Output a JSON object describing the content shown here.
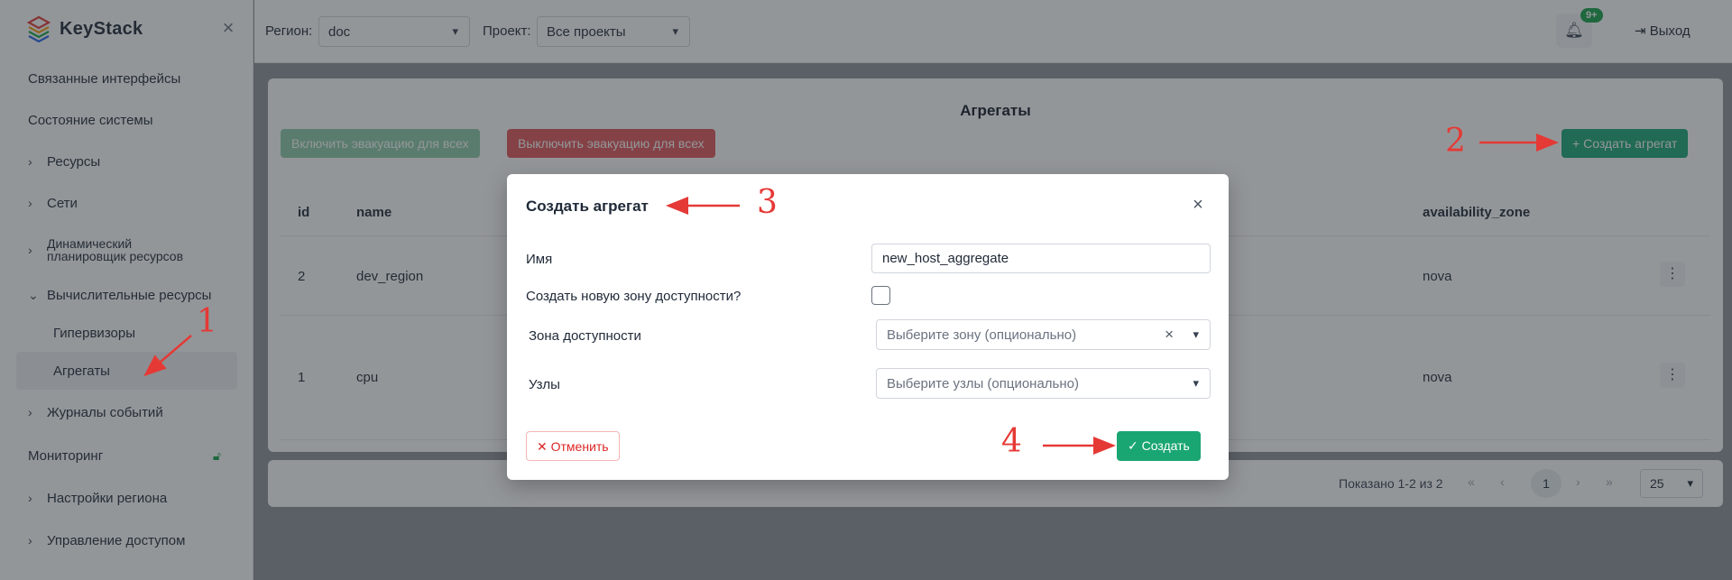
{
  "app": {
    "logo_text": "KeyStack",
    "logo_colors": [
      "#e53935",
      "#f59e0b",
      "#16a34a",
      "#2563eb"
    ]
  },
  "sidebar": {
    "items": [
      {
        "label": "Связанные интерфейсы"
      },
      {
        "label": "Состояние системы"
      },
      {
        "label": "Ресурсы",
        "chevron": "chevron-right-icon"
      },
      {
        "label": "Сети",
        "chevron": "chevron-right-icon"
      },
      {
        "label_line1": "Динамический",
        "label_line2": "планировщик ресурсов",
        "chevron": "chevron-right-icon"
      },
      {
        "label": "Вычислительные ресурсы",
        "chevron": "chevron-down-icon"
      },
      {
        "label": "Гипервизоры"
      },
      {
        "label": "Агрегаты",
        "active": true
      },
      {
        "label": "Журналы событий",
        "chevron": "chevron-right-icon"
      },
      {
        "label": "Мониторинг",
        "icon": "lock-icon"
      },
      {
        "label": "Настройки региона",
        "chevron": "chevron-right-icon"
      },
      {
        "label": "Управление доступом",
        "chevron": "chevron-right-icon"
      }
    ]
  },
  "topbar": {
    "region_label": "Регион:",
    "region_value": "doc",
    "project_label": "Проект:",
    "project_value": "Все проекты",
    "notifications_badge": "9+",
    "logout_label": "Выход"
  },
  "page": {
    "title": "Агрегаты",
    "evac_on_label": "Включить эвакуацию для всех",
    "evac_off_label": "Выключить эвакуацию для всех",
    "create_label": "Создать агрегат",
    "table": {
      "columns": [
        "id",
        "name",
        "availability_zone"
      ],
      "rows": [
        {
          "id": "2",
          "name": "dev_region",
          "availability_zone": "nova"
        },
        {
          "id": "1",
          "name": "cpu",
          "availability_zone": "nova"
        }
      ]
    },
    "pager": {
      "info": "Показано 1-2 из 2",
      "current_page": "1",
      "per_page": "25"
    }
  },
  "modal": {
    "title": "Создать агрегат",
    "name_label": "Имя",
    "name_value": "new_host_aggregate",
    "new_zone_label": "Создать новую зону доступности?",
    "zone_label": "Зона доступности",
    "zone_placeholder": "Выберите зону (опционально)",
    "hosts_label": "Узлы",
    "hosts_placeholder": "Выберите узлы (опционально)",
    "cancel_label": "Отменить",
    "submit_label": "Создать"
  },
  "annotations": {
    "n1": "1",
    "n2": "2",
    "n3": "3",
    "n4": "4",
    "color": "#e53935"
  }
}
